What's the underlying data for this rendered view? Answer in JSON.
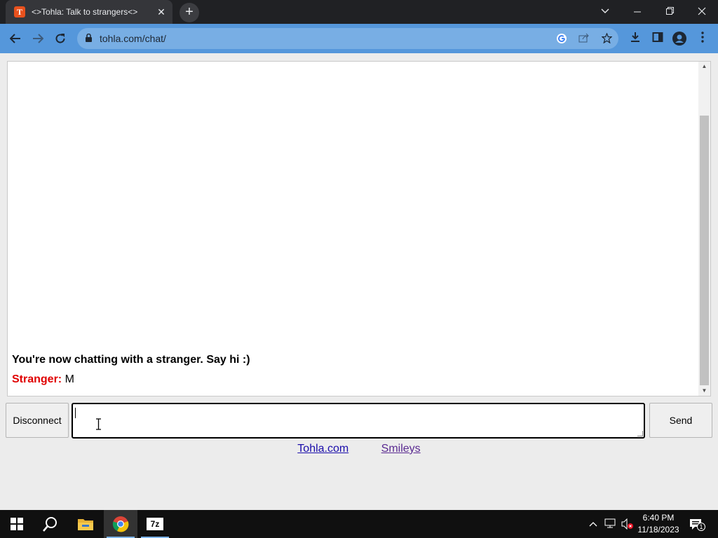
{
  "browser": {
    "tab_title": "<>Tohla: Talk to strangers<>",
    "favicon_letter": "T",
    "url": "tohla.com/chat/",
    "new_tab": "+",
    "tab_close": "✕"
  },
  "chat": {
    "system_message": "You're now chatting with a stranger. Say hi :)",
    "messages": [
      {
        "sender": "Stranger:",
        "text": "M"
      }
    ]
  },
  "controls": {
    "disconnect_label": "Disconnect",
    "send_label": "Send",
    "input_value": ""
  },
  "footer": {
    "links": [
      "Tohla.com",
      "Smileys"
    ]
  },
  "taskbar": {
    "time": "6:40 PM",
    "date": "11/18/2023",
    "notification_count": "1",
    "app_7z": "7z"
  },
  "colors": {
    "stranger_label": "#e00000",
    "toolbar": "#5597db",
    "page_bg": "#ececec"
  }
}
